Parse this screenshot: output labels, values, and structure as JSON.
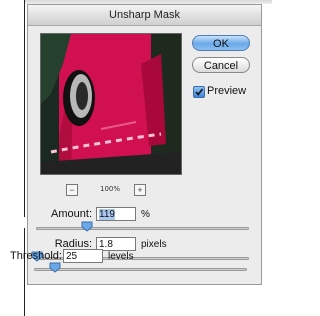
{
  "window": {
    "title": "Unsharp Mask"
  },
  "buttons": {
    "ok": "OK",
    "cancel": "Cancel"
  },
  "preview_option": {
    "label": "Preview",
    "checked": true
  },
  "zoom": {
    "minus": "−",
    "plus": "+",
    "level": "100%"
  },
  "fields": [
    {
      "label": "Amount:",
      "value": "119",
      "unit": "%",
      "slider_fraction": 0.238
    },
    {
      "label": "Radius:",
      "value": "1.8",
      "unit": "pixels",
      "slider_fraction": 0.007
    },
    {
      "label": "Threshold:",
      "value": "25",
      "unit": "levels",
      "slider_fraction": 0.098
    }
  ],
  "colors": {
    "accent": "#4f7fb2",
    "preview_magenta": "#d01050",
    "slider_knob": "#6aa8e8"
  }
}
